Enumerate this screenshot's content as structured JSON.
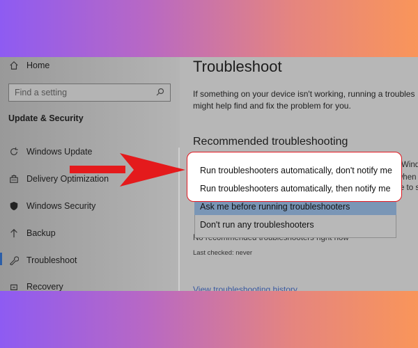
{
  "sidebar": {
    "home_label": "Home",
    "search_placeholder": "Find a setting",
    "section_title": "Update & Security",
    "items": [
      {
        "label": "Windows Update",
        "icon": "refresh-icon"
      },
      {
        "label": "Delivery Optimization",
        "icon": "delivery-icon"
      },
      {
        "label": "Windows Security",
        "icon": "shield-icon"
      },
      {
        "label": "Backup",
        "icon": "upload-arrow-icon"
      },
      {
        "label": "Troubleshoot",
        "icon": "wrench-icon"
      },
      {
        "label": "Recovery",
        "icon": "recovery-icon"
      }
    ]
  },
  "main": {
    "title": "Troubleshoot",
    "description_line1": "If something on your device isn't working, running a troubles",
    "description_line2": "might help find and fix the problem for you.",
    "recommended_title": "Recommended troubleshooting",
    "behind_text_1": "Wind",
    "behind_text_2": "when s",
    "behind_text_3": "ble to s",
    "no_recommended_text": "No recommended troubleshooters right now",
    "last_checked": "Last checked: never",
    "history_link": "View troubleshooting history"
  },
  "dropdown": {
    "options": [
      "Run troubleshooters automatically, don't notify me",
      "Run troubleshooters automatically, then notify me",
      "Ask me before running troubleshooters",
      "Don't run any troubleshooters"
    ],
    "selected_index": 2
  },
  "colors": {
    "accent": "#2b5ea8",
    "highlight_border": "#e1151e",
    "arrow": "#e41a1c"
  }
}
